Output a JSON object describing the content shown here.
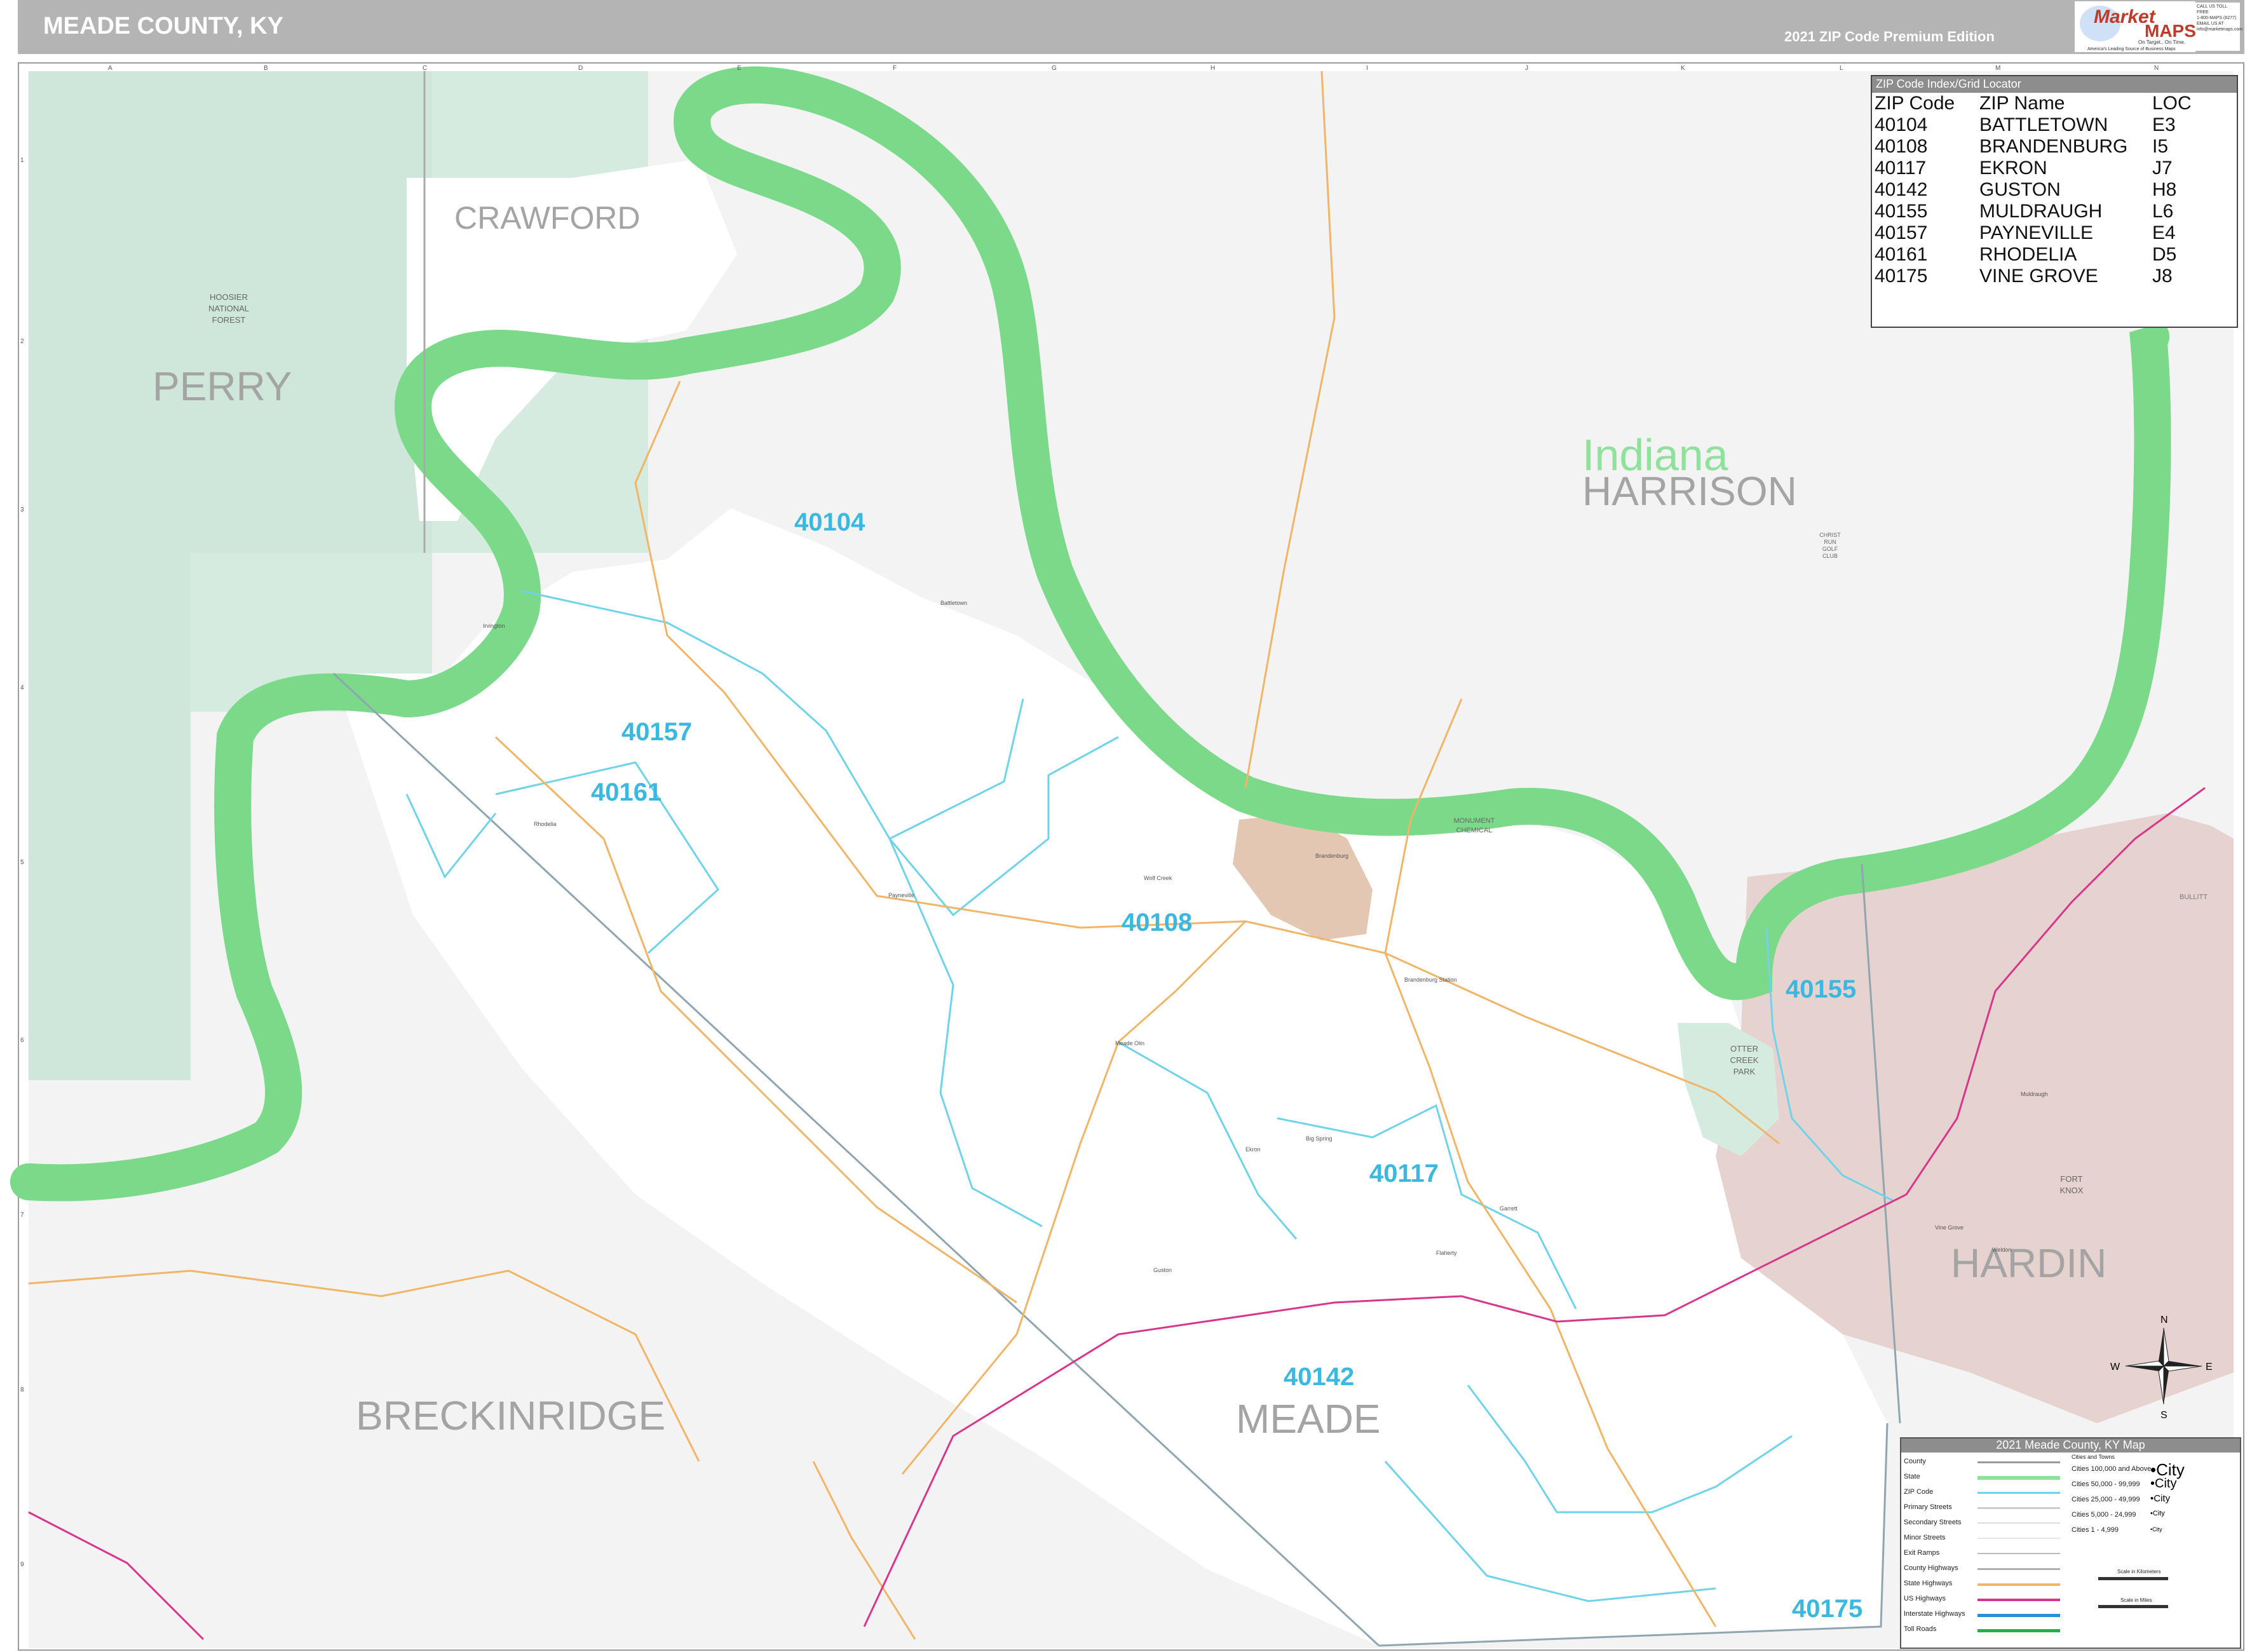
{
  "header": {
    "title": "MEADE COUNTY, KY",
    "edition": "2021 ZIP Code Premium Edition"
  },
  "logo": {
    "brand_top": "Market",
    "brand_bottom": "MAPS",
    "tagline1": "On Target.. On Time.",
    "tagline2": "America's Leading Source of Business Maps",
    "contact": [
      "CALL US TOLL FREE",
      "1-800-MAPS (6277)",
      "EMAIL US AT",
      "info@marketmaps.com"
    ]
  },
  "grid": {
    "columns": [
      "A",
      "B",
      "C",
      "D",
      "E",
      "F",
      "G",
      "H",
      "I",
      "J",
      "K",
      "L",
      "M",
      "N"
    ],
    "rows": [
      "1",
      "2",
      "3",
      "4",
      "5",
      "6",
      "7",
      "8",
      "9"
    ]
  },
  "counties": {
    "perry": "PERRY",
    "crawford": "CRAWFORD",
    "harrison": "HARRISON",
    "breckinridge": "BRECKINRIDGE",
    "meade": "MEADE",
    "hardin": "HARDIN",
    "bullitt": "BULLITT"
  },
  "state_label": "Indiana",
  "zip_labels": [
    "40104",
    "40157",
    "40161",
    "40108",
    "40155",
    "40117",
    "40142",
    "40175"
  ],
  "places": {
    "hoosier": [
      "HOOSIER",
      "NATIONAL",
      "FOREST"
    ],
    "otter_creek": [
      "OTTER",
      "CREEK",
      "PARK"
    ],
    "fort_knox": [
      "FORT",
      "KNOX"
    ],
    "monument": [
      "MONUMENT",
      "CHEMICAL"
    ],
    "christ_run": [
      "CHRIST",
      "RUN",
      "GOLF",
      "CLUB"
    ],
    "towns": [
      "Battletown",
      "Payneville",
      "Rhodelia",
      "Brandenburg",
      "Ekron",
      "Guston",
      "Muldraugh",
      "Vine Grove",
      "Meade Olin",
      "Brandenburg Station",
      "Irvington",
      "Garrett",
      "Flaherty",
      "Big Spring",
      "Weldon",
      "Wolf Creek"
    ]
  },
  "zip_index": {
    "title": "ZIP Code Index/Grid Locator",
    "headers": [
      "ZIP Code",
      "ZIP Name",
      "LOC"
    ],
    "rows": [
      [
        "40104",
        "BATTLETOWN",
        "E3"
      ],
      [
        "40108",
        "BRANDENBURG",
        "I5"
      ],
      [
        "40117",
        "EKRON",
        "J7"
      ],
      [
        "40142",
        "GUSTON",
        "H8"
      ],
      [
        "40155",
        "MULDRAUGH",
        "L6"
      ],
      [
        "40157",
        "PAYNEVILLE",
        "E4"
      ],
      [
        "40161",
        "RHODELIA",
        "D5"
      ],
      [
        "40175",
        "VINE GROVE",
        "J8"
      ]
    ]
  },
  "legend": {
    "title": "2021 Meade County, KY Map",
    "items": [
      "County",
      "State",
      "ZIP Code",
      "Primary Streets",
      "Secondary Streets",
      "Minor Streets",
      "Exit Ramps",
      "County Highways",
      "State Highways",
      "US Highways",
      "Interstate Highways",
      "Toll Roads"
    ],
    "cities_header": "Cities and Towns",
    "cities": [
      "Cities 100,000 and Above",
      "Cities 50,000 - 99,999",
      "Cities 25,000 - 49,999",
      "Cities 5,000 - 24,999",
      "Cities 1 - 4,999"
    ],
    "city_samples": [
      "•City",
      "•City",
      "•City",
      "•City",
      "•City"
    ],
    "scale_km": "Scale in Kilometers",
    "scale_mi": "Scale in Miles"
  },
  "compass": {
    "n": "N",
    "s": "S",
    "e": "E",
    "w": "W"
  },
  "colors": {
    "river": "#aee6f0",
    "river_edge": "#7bd98a",
    "land": "#f3f3f3",
    "county_fill": "#ffffff",
    "forest": "#d5ebe0",
    "urban": "#e6d2cf",
    "brandenburg": "#e3c7b2",
    "zip_line": "#6fd3ea",
    "zip_label": "#3ab8e0",
    "county_label": "#a4a4a4",
    "state_label": "#8fe29b",
    "state_highway": "#f0b567",
    "us_highway": "#d8368c"
  }
}
